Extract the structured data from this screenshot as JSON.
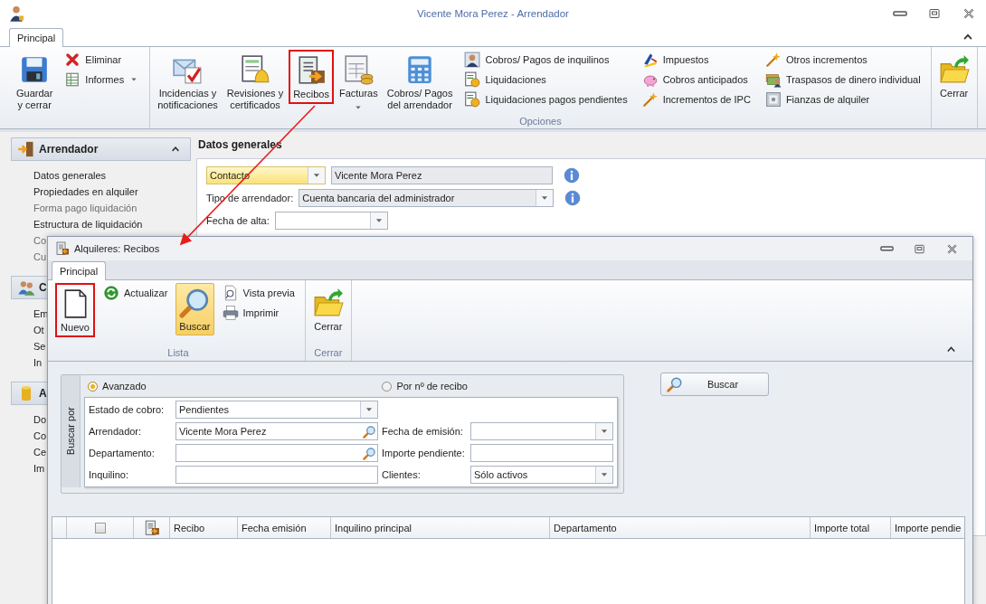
{
  "window": {
    "title": "Vicente Mora Perez - Arrendador"
  },
  "tabs": [
    {
      "label": "Principal",
      "selected": true
    }
  ],
  "ribbon": {
    "groups": [
      {
        "columns": [
          {
            "kind": "large",
            "buttons": [
              {
                "label": "Guardar\ny cerrar",
                "highlighted": false,
                "dropdown": false
              }
            ]
          },
          {
            "kind": "stack",
            "buttons": [
              {
                "label": "Eliminar",
                "highlighted": false,
                "dropdown": false
              },
              {
                "label": "Informes",
                "highlighted": false,
                "dropdown": true
              }
            ]
          }
        ]
      },
      {
        "label": "Opciones",
        "columns": [
          {
            "kind": "large",
            "buttons": [
              {
                "label": "Incidencias y\nnotificaciones",
                "highlighted": false,
                "dropdown": false
              }
            ]
          },
          {
            "kind": "large",
            "buttons": [
              {
                "label": "Revisiones y\ncertificados",
                "highlighted": false,
                "dropdown": false
              }
            ]
          },
          {
            "kind": "large",
            "buttons": [
              {
                "label": "Recibos",
                "highlighted": true,
                "dropdown": false
              }
            ]
          },
          {
            "kind": "large",
            "buttons": [
              {
                "label": "Facturas",
                "highlighted": false,
                "dropdown": true
              }
            ]
          },
          {
            "kind": "large",
            "buttons": [
              {
                "label": "Cobros/ Pagos\ndel arrendador",
                "highlighted": false,
                "dropdown": false
              }
            ]
          },
          {
            "kind": "stack",
            "buttons": [
              {
                "label": "Cobros/ Pagos de inquilinos",
                "highlighted": false,
                "dropdown": false
              },
              {
                "label": "Liquidaciones",
                "highlighted": false,
                "dropdown": false
              },
              {
                "label": "Liquidaciones pagos pendientes",
                "highlighted": false,
                "dropdown": false
              }
            ]
          },
          {
            "kind": "stack",
            "buttons": [
              {
                "label": "Impuestos",
                "highlighted": false,
                "dropdown": false
              },
              {
                "label": "Cobros anticipados",
                "highlighted": false,
                "dropdown": false
              },
              {
                "label": "Incrementos de IPC",
                "highlighted": false,
                "dropdown": false
              }
            ]
          },
          {
            "kind": "stack",
            "buttons": [
              {
                "label": "Otros incrementos",
                "highlighted": false,
                "dropdown": false
              },
              {
                "label": "Traspasos de dinero individual",
                "highlighted": false,
                "dropdown": false
              },
              {
                "label": "Fianzas de alquiler",
                "highlighted": false,
                "dropdown": false
              }
            ]
          }
        ]
      },
      {
        "columns": [
          {
            "kind": "large",
            "buttons": [
              {
                "label": "Cerrar",
                "highlighted": false,
                "dropdown": false
              }
            ]
          }
        ]
      }
    ]
  },
  "sidebar": {
    "sections": [
      {
        "title": "Arrendador",
        "items": [
          {
            "label": "Datos generales",
            "disabled": false
          },
          {
            "label": "Propiedades en alquiler",
            "disabled": false
          },
          {
            "label": "Forma pago liquidación",
            "disabled": true
          },
          {
            "label": "Estructura de liquidación",
            "disabled": false
          },
          {
            "label": "Co",
            "disabled": true
          },
          {
            "label": "Cu",
            "disabled": true
          }
        ]
      },
      {
        "title": "C",
        "items": [
          {
            "label": "Em",
            "disabled": false
          },
          {
            "label": "Ot",
            "disabled": false
          },
          {
            "label": "Se",
            "disabled": false
          },
          {
            "label": "In",
            "disabled": false
          }
        ]
      },
      {
        "title": "A",
        "items": [
          {
            "label": "Do",
            "disabled": false
          },
          {
            "label": "Co",
            "disabled": false
          },
          {
            "label": "Ce",
            "disabled": false
          },
          {
            "label": "Im",
            "disabled": false
          }
        ]
      }
    ]
  },
  "form": {
    "title": "Datos generales",
    "rows": [
      {
        "fields": [
          {
            "kind": "combo",
            "value": "Contacto",
            "highlighted": true,
            "disabled": false
          },
          {
            "kind": "text",
            "value": "Vicente Mora Perez",
            "highlighted": false,
            "disabled": true
          }
        ],
        "info": true
      },
      {
        "label": "Tipo de arrendador:",
        "fields": [
          {
            "kind": "combo",
            "value": "Cuenta bancaria del administrador",
            "highlighted": false,
            "disabled": true
          }
        ],
        "info": true
      },
      {
        "label": "Fecha de alta:",
        "fields": [
          {
            "kind": "combo",
            "highlighted": false,
            "disabled": false
          }
        ],
        "info": false
      }
    ]
  },
  "dialog": {
    "title": "Alquileres: Recibos",
    "tabs": [
      {
        "label": "Principal",
        "selected": true
      }
    ],
    "ribbon": {
      "groups": [
        {
          "label": "Lista",
          "columns": [
            {
              "kind": "large",
              "buttons": [
                {
                  "label": "Nuevo",
                  "highlighted": true,
                  "pressed": false
                }
              ]
            },
            {
              "kind": "stack",
              "buttons": [
                {
                  "label": "Actualizar",
                  "highlighted": false,
                  "pressed": false
                }
              ]
            },
            {
              "kind": "large",
              "buttons": [
                {
                  "label": "Buscar",
                  "highlighted": false,
                  "pressed": true
                }
              ]
            },
            {
              "kind": "stack",
              "buttons": [
                {
                  "label": "Vista previa",
                  "highlighted": false,
                  "pressed": false
                },
                {
                  "label": "Imprimir",
                  "highlighted": false,
                  "pressed": false
                }
              ]
            }
          ]
        },
        {
          "label": "Cerrar",
          "columns": [
            {
              "kind": "large",
              "buttons": [
                {
                  "label": "Cerrar",
                  "highlighted": false,
                  "pressed": false
                }
              ]
            }
          ]
        }
      ]
    },
    "search": {
      "title": "Buscar por",
      "modes": [
        {
          "label": "Avanzado",
          "selected": true
        },
        {
          "label": "Por nº de recibo",
          "selected": false
        }
      ],
      "rows": [
        {
          "left": {
            "label": "Estado de cobro:",
            "kind": "combo",
            "value": "Pendientes"
          }
        },
        {
          "left": {
            "label": "Arrendador:",
            "kind": "lookup",
            "value": "Vicente Mora Perez"
          },
          "right": {
            "label": "Fecha de emisión:",
            "kind": "combo"
          }
        },
        {
          "left": {
            "label": "Departamento:",
            "kind": "lookup"
          },
          "right": {
            "label": "Importe pendiente:",
            "kind": "text"
          }
        },
        {
          "left": {
            "label": "Inquilino:",
            "kind": "text"
          },
          "right": {
            "label": "Clientes:",
            "kind": "combo",
            "value": "Sólo activos"
          }
        }
      ],
      "button": "Buscar"
    },
    "table": {
      "select_all": {
        "checked": false
      },
      "columns": [
        "Recibo",
        "Fecha emisión",
        "Inquilino principal",
        "Departamento",
        "Importe total",
        "Importe pendie"
      ]
    }
  }
}
